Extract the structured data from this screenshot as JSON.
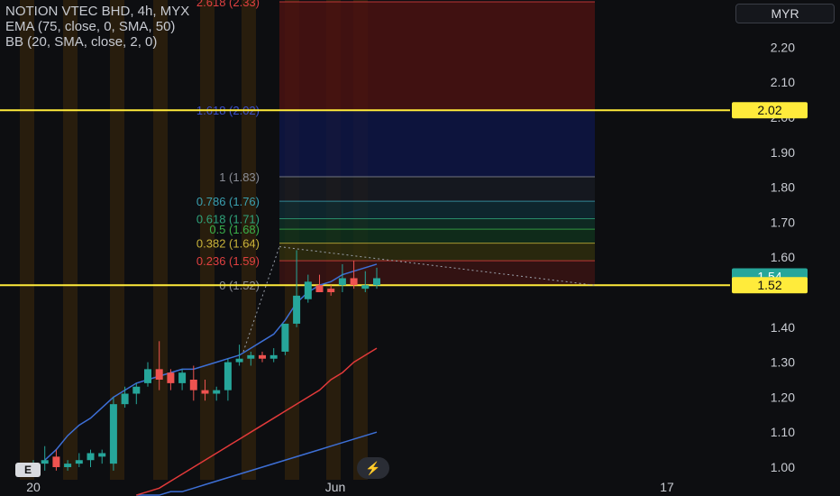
{
  "legend": {
    "title": "NOTION VTEC BHD, 4h, MYX",
    "ema": "EMA (75, close, 0, SMA, 50)",
    "bb": "BB (20, SMA, close, 2, 0)"
  },
  "currency": "MYR",
  "bottom_left_button": "E",
  "colors": {
    "up": "#26a69a",
    "down": "#ef5350",
    "bb_band": "#3d6fd6",
    "ema": "#e23a3a",
    "yellow_line": "#ffeb3b",
    "background": "#0d0e11"
  },
  "chart_data": {
    "type": "candlestick",
    "ylim": [
      0.98,
      2.32
    ],
    "y_ticks": [
      "2.20",
      "2.10",
      "2.00",
      "1.90",
      "1.80",
      "1.70",
      "1.60",
      "1.40",
      "1.30",
      "1.20",
      "1.10",
      "1.00"
    ],
    "x_ticks": [
      "20",
      "Jun",
      "17"
    ],
    "price_labels": [
      {
        "text": "2.02",
        "value": 2.02,
        "style": "yellow"
      },
      {
        "text": "1.54",
        "value": 1.545,
        "style": "green"
      },
      {
        "text": "1.52",
        "value": 1.52,
        "style": "yellow"
      }
    ],
    "horizontal_lines": [
      2.02,
      1.52
    ],
    "fib_levels": [
      {
        "label": "2.618 (2.33)",
        "value": 2.33
      },
      {
        "label": "1.618 (2.02)",
        "value": 2.02
      },
      {
        "label": "1 (1.83)",
        "value": 1.83
      },
      {
        "label": "0.786 (1.76)",
        "value": 1.76
      },
      {
        "label": "0.618 (1.71)",
        "value": 1.71
      },
      {
        "label": "0.5 (1.68)",
        "value": 1.68
      },
      {
        "label": "0.382 (1.64)",
        "value": 1.64
      },
      {
        "label": "0.236 (1.59)",
        "value": 1.59
      },
      {
        "label": "0 (1.52)",
        "value": 1.52
      }
    ],
    "candles": [
      {
        "o": 1.0,
        "h": 1.02,
        "l": 0.99,
        "c": 1.01
      },
      {
        "o": 1.01,
        "h": 1.06,
        "l": 0.99,
        "c": 1.02
      },
      {
        "o": 1.03,
        "h": 1.05,
        "l": 0.99,
        "c": 1.0
      },
      {
        "o": 1.0,
        "h": 1.02,
        "l": 0.99,
        "c": 1.01
      },
      {
        "o": 1.01,
        "h": 1.04,
        "l": 1.0,
        "c": 1.02
      },
      {
        "o": 1.02,
        "h": 1.05,
        "l": 1.0,
        "c": 1.04
      },
      {
        "o": 1.03,
        "h": 1.05,
        "l": 1.01,
        "c": 1.04
      },
      {
        "o": 1.01,
        "h": 1.2,
        "l": 0.99,
        "c": 1.18
      },
      {
        "o": 1.18,
        "h": 1.23,
        "l": 1.17,
        "c": 1.21
      },
      {
        "o": 1.21,
        "h": 1.24,
        "l": 1.18,
        "c": 1.23
      },
      {
        "o": 1.24,
        "h": 1.3,
        "l": 1.23,
        "c": 1.28
      },
      {
        "o": 1.28,
        "h": 1.36,
        "l": 1.22,
        "c": 1.25
      },
      {
        "o": 1.27,
        "h": 1.28,
        "l": 1.22,
        "c": 1.24
      },
      {
        "o": 1.24,
        "h": 1.28,
        "l": 1.22,
        "c": 1.27
      },
      {
        "o": 1.25,
        "h": 1.29,
        "l": 1.19,
        "c": 1.22
      },
      {
        "o": 1.22,
        "h": 1.25,
        "l": 1.19,
        "c": 1.21
      },
      {
        "o": 1.21,
        "h": 1.23,
        "l": 1.19,
        "c": 1.22
      },
      {
        "o": 1.22,
        "h": 1.31,
        "l": 1.19,
        "c": 1.3
      },
      {
        "o": 1.3,
        "h": 1.35,
        "l": 1.29,
        "c": 1.31
      },
      {
        "o": 1.31,
        "h": 1.33,
        "l": 1.29,
        "c": 1.32
      },
      {
        "o": 1.32,
        "h": 1.33,
        "l": 1.3,
        "c": 1.31
      },
      {
        "o": 1.31,
        "h": 1.34,
        "l": 1.3,
        "c": 1.32
      },
      {
        "o": 1.33,
        "h": 1.41,
        "l": 1.32,
        "c": 1.41
      },
      {
        "o": 1.41,
        "h": 1.62,
        "l": 1.4,
        "c": 1.49
      },
      {
        "o": 1.48,
        "h": 1.55,
        "l": 1.47,
        "c": 1.53
      },
      {
        "o": 1.52,
        "h": 1.55,
        "l": 1.5,
        "c": 1.5
      },
      {
        "o": 1.51,
        "h": 1.52,
        "l": 1.49,
        "c": 1.5
      },
      {
        "o": 1.52,
        "h": 1.58,
        "l": 1.5,
        "c": 1.54
      },
      {
        "o": 1.54,
        "h": 1.59,
        "l": 1.51,
        "c": 1.52
      },
      {
        "o": 1.51,
        "h": 1.56,
        "l": 1.5,
        "c": 1.52
      },
      {
        "o": 1.52,
        "h": 1.57,
        "l": 1.51,
        "c": 1.54
      }
    ],
    "bb_upper": [
      1.02,
      1.05,
      1.09,
      1.12,
      1.14,
      1.17,
      1.2,
      1.22,
      1.24,
      1.25,
      1.26,
      1.27,
      1.28,
      1.28,
      1.29,
      1.3,
      1.31,
      1.32,
      1.34,
      1.36,
      1.38,
      1.42,
      1.47,
      1.5,
      1.52,
      1.53,
      1.55,
      1.56,
      1.57,
      1.58
    ],
    "bb_basis": [
      1.0,
      1.01,
      1.02,
      1.03,
      1.05,
      1.07,
      1.09,
      1.1,
      1.12,
      1.13,
      1.14,
      1.15,
      1.16,
      1.17,
      1.18,
      1.19,
      1.2,
      1.21,
      1.22,
      1.24,
      1.26,
      1.28,
      1.31,
      1.34,
      1.37,
      1.4,
      1.42,
      1.44,
      1.46,
      1.48
    ],
    "bb_lower": [
      0.92,
      0.92,
      0.92,
      0.93,
      0.93,
      0.94,
      0.95,
      0.96,
      0.97,
      0.98,
      0.99,
      1.0,
      1.01,
      1.02,
      1.03,
      1.04,
      1.05,
      1.06,
      1.07,
      1.08,
      1.09,
      1.1
    ],
    "ema": [
      0.92,
      0.93,
      0.94,
      0.96,
      0.98,
      1.0,
      1.02,
      1.04,
      1.06,
      1.08,
      1.1,
      1.12,
      1.14,
      1.16,
      1.18,
      1.2,
      1.22,
      1.25,
      1.27,
      1.3,
      1.32,
      1.34
    ]
  }
}
